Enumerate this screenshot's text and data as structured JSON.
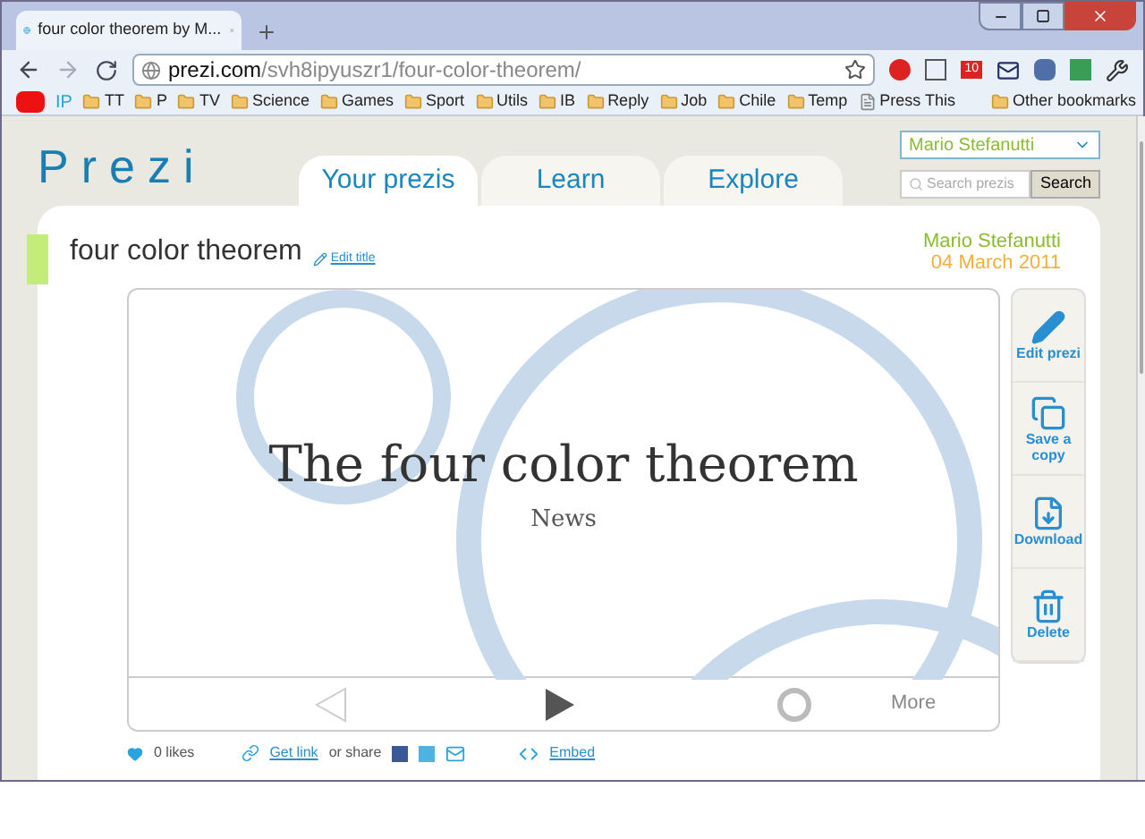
{
  "browser": {
    "tab_title": "four color theorem by M...",
    "url_host": "prezi.com",
    "url_path": "/svh8ipyuszr1/four-color-theorem/",
    "bookmarks": [
      {
        "kind": "logo"
      },
      {
        "kind": "text",
        "label": "IP"
      },
      {
        "kind": "folder",
        "label": "TT"
      },
      {
        "kind": "folder",
        "label": "P"
      },
      {
        "kind": "folder",
        "label": "TV"
      },
      {
        "kind": "folder",
        "label": "Science"
      },
      {
        "kind": "folder",
        "label": "Games"
      },
      {
        "kind": "folder",
        "label": "Sport"
      },
      {
        "kind": "folder",
        "label": "Utils"
      },
      {
        "kind": "folder",
        "label": "IB"
      },
      {
        "kind": "folder",
        "label": "Reply"
      },
      {
        "kind": "folder",
        "label": "Job"
      },
      {
        "kind": "folder",
        "label": "Chile"
      },
      {
        "kind": "folder",
        "label": "Temp"
      },
      {
        "kind": "page",
        "label": "Press This"
      }
    ],
    "other_bookmarks": "Other bookmarks",
    "extension_badge": "10"
  },
  "site": {
    "logo": "Prezi",
    "tabs": [
      {
        "label": "Your prezis",
        "selected": true
      },
      {
        "label": "Learn",
        "selected": false
      },
      {
        "label": "Explore",
        "selected": false
      }
    ],
    "user_menu": "Mario Stefanutti",
    "search": {
      "placeholder": "Search prezis",
      "button": "Search"
    }
  },
  "prezi": {
    "title": "four color theorem",
    "edit_title": "Edit title",
    "author": "Mario Stefanutti",
    "date": "04 March 2011",
    "slide_title": "The four color theorem",
    "slide_subtitle": "News",
    "more": "More",
    "actions": [
      {
        "kind": "edit",
        "label": "Edit prezi"
      },
      {
        "kind": "copy",
        "label": "Save a copy"
      },
      {
        "kind": "download",
        "label": "Download"
      },
      {
        "kind": "delete",
        "label": "Delete"
      }
    ]
  },
  "footer": {
    "likes": "0 likes",
    "get_link": "Get link",
    "or_share": "or share",
    "embed": "Embed"
  }
}
